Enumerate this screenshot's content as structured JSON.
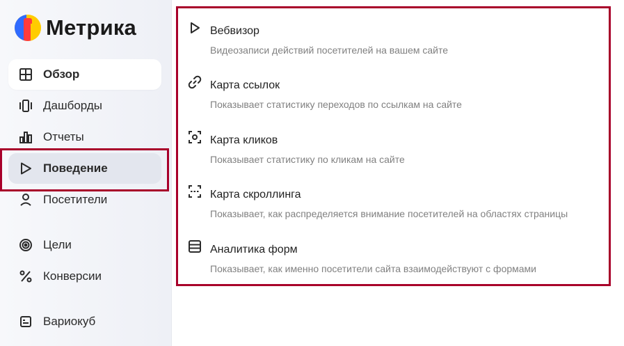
{
  "app": {
    "title": "Метрика"
  },
  "sidebar": {
    "items": [
      {
        "label": "Обзор",
        "icon": "grid-icon"
      },
      {
        "label": "Дашборды",
        "icon": "dashboards-icon"
      },
      {
        "label": "Отчеты",
        "icon": "bar-chart-icon"
      },
      {
        "label": "Поведение",
        "icon": "play-icon"
      },
      {
        "label": "Посетители",
        "icon": "user-icon"
      },
      {
        "label": "Цели",
        "icon": "target-icon"
      },
      {
        "label": "Конверсии",
        "icon": "percent-icon"
      },
      {
        "label": "Вариокуб",
        "icon": "variokub-icon"
      }
    ]
  },
  "behavior_menu": {
    "items": [
      {
        "title": "Вебвизор",
        "description": "Видеозаписи действий посетителей на вашем сайте",
        "icon": "play-icon"
      },
      {
        "title": "Карта ссылок",
        "description": "Показывает статистику переходов по ссылкам на сайте",
        "icon": "link-icon"
      },
      {
        "title": "Карта кликов",
        "description": "Показывает статистику по кликам на сайте",
        "icon": "click-target-icon"
      },
      {
        "title": "Карта скроллинга",
        "description": "Показывает, как распределяется внимание посетителей на областях страницы",
        "icon": "scroll-frame-icon"
      },
      {
        "title": "Аналитика форм",
        "description": "Показывает, как именно посетители сайта взаимодействуют с формами",
        "icon": "form-icon"
      }
    ]
  },
  "colors": {
    "highlight": "#a8002a",
    "logo_blue": "#2f6bff",
    "logo_red": "#ff3b3b",
    "logo_yellow": "#ffcc00"
  }
}
